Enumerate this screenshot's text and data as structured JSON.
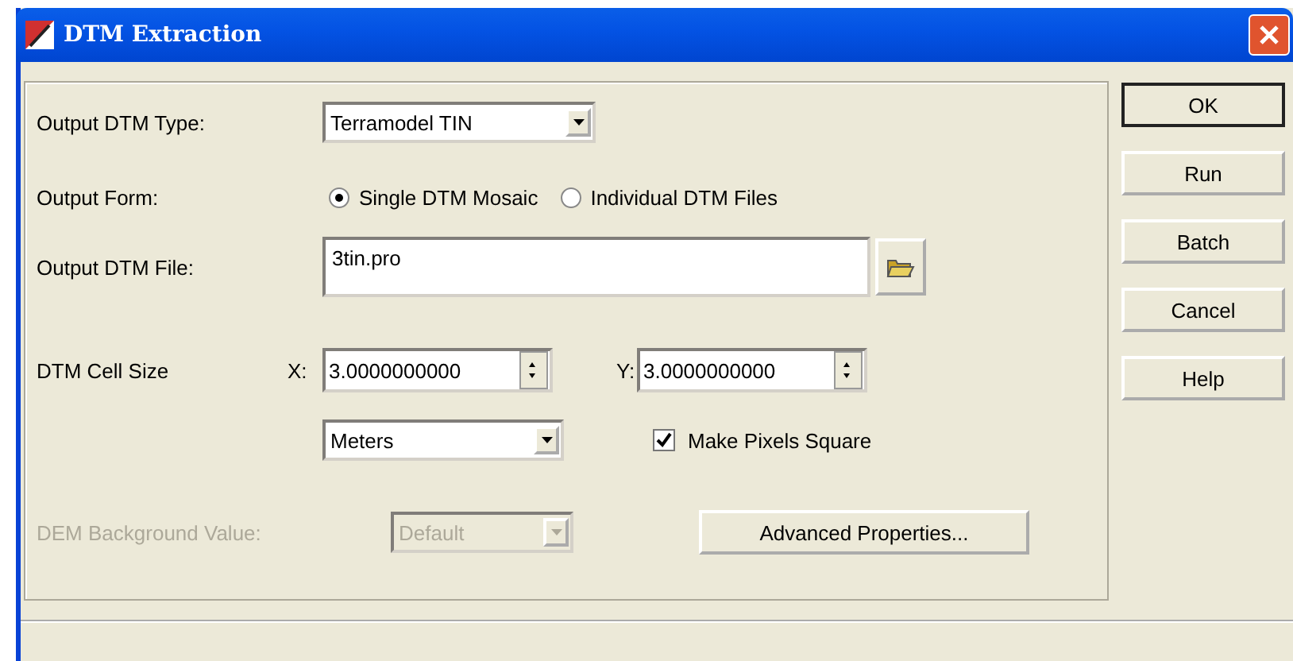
{
  "window": {
    "title": "DTM Extraction"
  },
  "output_type": {
    "label": "Output DTM Type:",
    "value": "Terramodel TIN"
  },
  "output_form": {
    "label": "Output Form:",
    "options": [
      {
        "label": "Single DTM Mosaic",
        "selected": true
      },
      {
        "label": "Individual DTM Files",
        "selected": false
      }
    ]
  },
  "output_file": {
    "label": "Output DTM File:",
    "value": "3tin.pro"
  },
  "cell_size": {
    "label": "DTM Cell Size",
    "x_label": "X:",
    "x_value": "3.0000000000",
    "y_label": "Y:",
    "y_value": "3.0000000000",
    "units": "Meters",
    "square": {
      "label": "Make Pixels Square",
      "checked": true
    }
  },
  "background": {
    "label": "DEM Background Value:",
    "value": "Default",
    "disabled": true
  },
  "advanced_button": "Advanced Properties...",
  "buttons": [
    "OK",
    "Run",
    "Batch",
    "Cancel",
    "Help"
  ]
}
